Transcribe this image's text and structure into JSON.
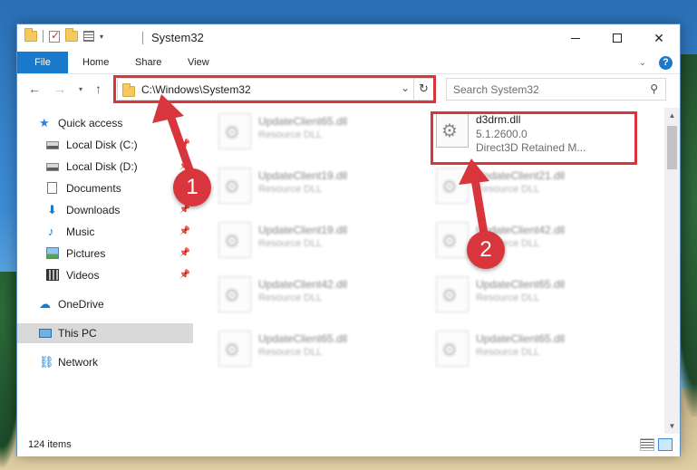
{
  "window": {
    "title": "System32",
    "controls": {
      "minimize": "minimize",
      "maximize": "maximize",
      "close": "✕"
    }
  },
  "ribbon": {
    "tabs": [
      {
        "label": "File",
        "active": true
      },
      {
        "label": "Home"
      },
      {
        "label": "Share"
      },
      {
        "label": "View"
      }
    ],
    "help": "?"
  },
  "nav": {
    "address": "C:\\Windows\\System32",
    "search_placeholder": "Search System32"
  },
  "sidebar": {
    "items": [
      {
        "label": "Quick access",
        "icon": "star-icon"
      },
      {
        "label": "Local Disk (C:)",
        "icon": "disk-icon"
      },
      {
        "label": "Local Disk (D:)",
        "icon": "disk-icon"
      },
      {
        "label": "Documents",
        "icon": "document-icon",
        "pinned": true
      },
      {
        "label": "Downloads",
        "icon": "download-icon",
        "pinned": true
      },
      {
        "label": "Music",
        "icon": "music-icon",
        "pinned": true
      },
      {
        "label": "Pictures",
        "icon": "pictures-icon",
        "pinned": true
      },
      {
        "label": "Videos",
        "icon": "videos-icon",
        "pinned": true
      },
      {
        "label": "OneDrive",
        "icon": "onedrive-icon"
      },
      {
        "label": "This PC",
        "icon": "this-pc-icon",
        "selected": true
      },
      {
        "label": "Network",
        "icon": "network-icon"
      }
    ]
  },
  "files": {
    "target": {
      "name": "d3drm.dll",
      "version": "5.1.2600.0",
      "description": "Direct3D Retained M..."
    },
    "left_column": [
      {
        "name": "UpdateClient65.dll",
        "type": "Resource DLL"
      },
      {
        "name": "UpdateClient19.dll",
        "type": "Resource DLL"
      },
      {
        "name": "UpdateClient19.dll",
        "type": "Resource DLL"
      },
      {
        "name": "UpdateClient42.dll",
        "type": "Resource DLL"
      },
      {
        "name": "UpdateClient65.dll",
        "type": "Resource DLL"
      }
    ],
    "right_column": [
      {
        "name": "UpdateClient21.dll",
        "type": "Resource DLL"
      },
      {
        "name": "UpdateClient42.dll",
        "type": "Resource DLL"
      },
      {
        "name": "UpdateClient65.dll",
        "type": "Resource DLL"
      },
      {
        "name": "UpdateClient65.dll",
        "type": "Resource DLL"
      }
    ]
  },
  "status": {
    "item_count": "124 items"
  },
  "annotations": {
    "step1": "1",
    "step2": "2",
    "color": "#d9353c"
  }
}
